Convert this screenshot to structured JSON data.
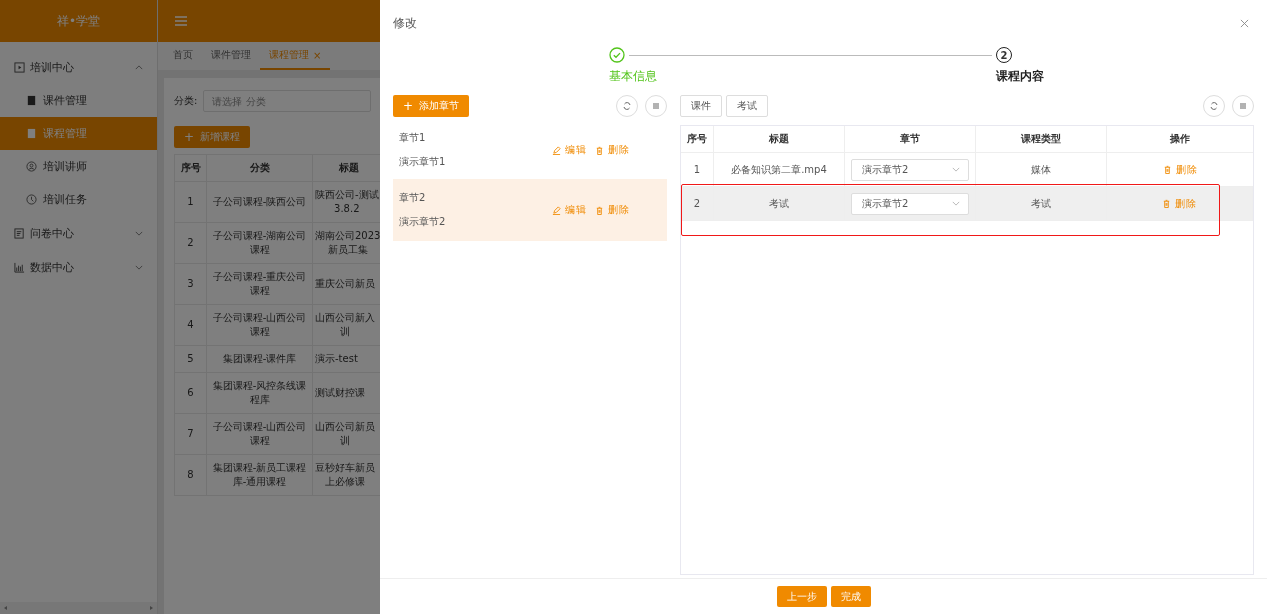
{
  "sidebar": {
    "logo": "祥•学堂",
    "items": [
      {
        "label": "培训中心",
        "expanded": true,
        "children": [
          {
            "label": "课件管理",
            "selected": false
          },
          {
            "label": "课程管理",
            "selected": true
          },
          {
            "label": "培训讲师",
            "selected": false
          },
          {
            "label": "培训任务",
            "selected": false
          }
        ]
      },
      {
        "label": "问卷中心",
        "expanded": false
      },
      {
        "label": "数据中心",
        "expanded": false
      }
    ]
  },
  "tabs": [
    {
      "label": "首页",
      "selected": false
    },
    {
      "label": "课件管理",
      "selected": false
    },
    {
      "label": "课程管理",
      "selected": true,
      "close": "×"
    }
  ],
  "filter": {
    "label": "分类:",
    "placeholder": "请选择 分类"
  },
  "add_course_button": {
    "plus": "+",
    "label": "新增课程"
  },
  "course_table": {
    "columns": [
      "序号",
      "分类",
      "标题"
    ],
    "rows": [
      {
        "no": "1",
        "category": "子公司课程-陕西公司",
        "title": [
          "陕西公司-测试",
          "3.8.2"
        ]
      },
      {
        "no": "2",
        "category": "子公司课程-湖南公司课程",
        "title": [
          "湖南公司2023",
          "新员工集"
        ]
      },
      {
        "no": "3",
        "category": "子公司课程-重庆公司课程",
        "title": [
          "重庆公司新员"
        ]
      },
      {
        "no": "4",
        "category": "子公司课程-山西公司课程",
        "title": [
          "山西公司新入",
          "训"
        ]
      },
      {
        "no": "5",
        "category": "集团课程-课件库",
        "title": [
          "演示-test"
        ]
      },
      {
        "no": "6",
        "category": "集团课程-风控条线课程库",
        "title": [
          "测试财控课"
        ]
      },
      {
        "no": "7",
        "category": "子公司课程-山西公司课程",
        "title": [
          "山西公司新员",
          "训"
        ]
      },
      {
        "no": "8",
        "category": "集团课程-新员工课程库-通用课程",
        "title": [
          "豆秒好车新员",
          "上必修课"
        ]
      }
    ]
  },
  "drawer": {
    "title": "修改",
    "steps": [
      {
        "label": "基本信息",
        "completed": true
      },
      {
        "label": "课程内容",
        "number": "2",
        "completed": false
      }
    ],
    "add_chapter_button": {
      "plus": "+",
      "label": "添加章节"
    },
    "chapters": [
      {
        "name": "章节1",
        "description": "演示章节1",
        "edit": "编辑",
        "delete": "删除",
        "selected": false
      },
      {
        "name": "章节2",
        "description": "演示章节2",
        "edit": "编辑",
        "delete": "删除",
        "selected": true
      }
    ],
    "type_buttons": [
      "课件",
      "考试"
    ],
    "table": {
      "columns": [
        "序号",
        "标题",
        "章节",
        "课程类型",
        "操作"
      ],
      "rows": [
        {
          "no": "1",
          "title": "必备知识第二章.mp4",
          "chapter": "演示章节2",
          "type": "媒体",
          "action": "删除",
          "hovered": false,
          "annotated": false
        },
        {
          "no": "2",
          "title": "考试",
          "chapter": "演示章节2",
          "type": "考试",
          "action": "删除",
          "hovered": true,
          "annotated": true
        }
      ]
    },
    "footer_buttons": [
      "上一步",
      "完成"
    ]
  }
}
